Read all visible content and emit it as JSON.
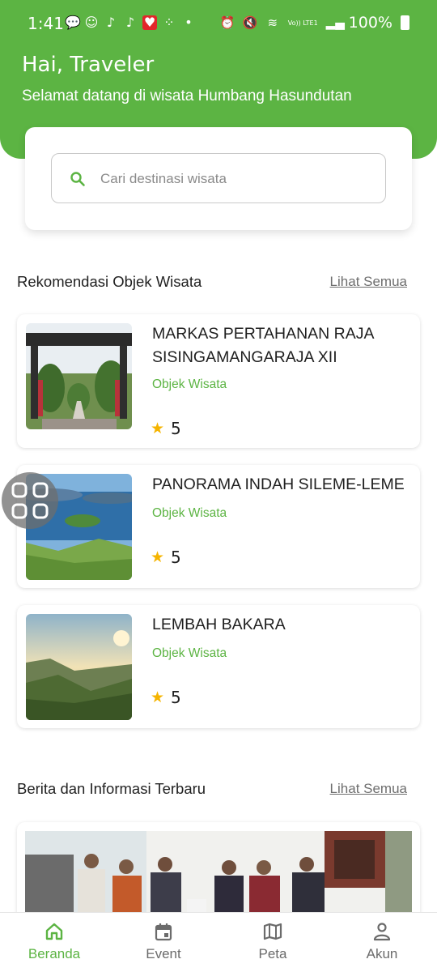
{
  "status_bar": {
    "time": "1:41",
    "battery": "100%",
    "network": "Vo)) LTE1"
  },
  "header": {
    "greeting": "Hai, Traveler",
    "subtitle": "Selamat datang di wisata Humbang Hasundutan"
  },
  "search": {
    "placeholder": "Cari destinasi wisata",
    "value": ""
  },
  "recommendations": {
    "title": "Rekomendasi Objek Wisata",
    "see_all": "Lihat Semua",
    "items": [
      {
        "name": "MARKAS PERTAHANAN RAJA SISINGAMANGARAJA XII",
        "category": "Objek Wisata",
        "rating": "5"
      },
      {
        "name": "PANORAMA INDAH SILEME-LEME",
        "category": "Objek Wisata",
        "rating": "5"
      },
      {
        "name": "LEMBAH BAKARA",
        "category": "Objek Wisata",
        "rating": "5"
      }
    ]
  },
  "news": {
    "title": "Berita dan Informasi Terbaru",
    "see_all": "Lihat Semua"
  },
  "bottom_nav": {
    "items": [
      {
        "label": "Beranda",
        "icon": "home-icon",
        "active": true
      },
      {
        "label": "Event",
        "icon": "calendar-icon",
        "active": false
      },
      {
        "label": "Peta",
        "icon": "map-icon",
        "active": false
      },
      {
        "label": "Akun",
        "icon": "person-icon",
        "active": false
      }
    ]
  },
  "colors": {
    "primary": "#5cb443",
    "star": "#f5b400",
    "text": "#1f1f1f",
    "muted": "#6b6b6b"
  }
}
